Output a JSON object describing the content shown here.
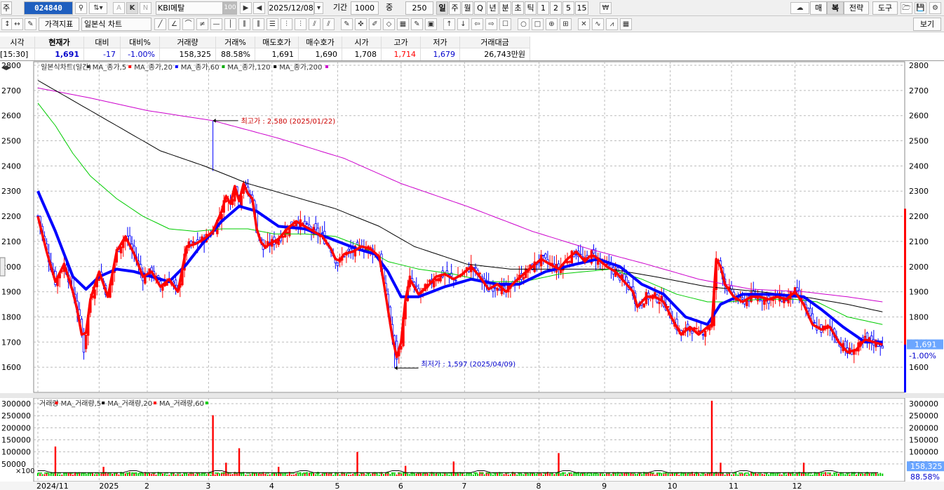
{
  "toolbar1": {
    "mode": "주",
    "code": "024840",
    "name": "KBI메탈",
    "count": "100",
    "date": "2025/12/08",
    "period_label": "기간",
    "period": "1000",
    "zoom_label": "중",
    "zoom": "250",
    "periods": [
      "일",
      "주",
      "월",
      "Q",
      "년",
      "분",
      "초",
      "틱",
      "1",
      "2",
      "5",
      "15"
    ],
    "right": [
      "매",
      "복",
      "전략",
      "도구"
    ],
    "small": [
      "K",
      "N"
    ]
  },
  "toolbar2": {
    "price_index": "가격지표",
    "chart_type": "일본식 차트",
    "view": "보기"
  },
  "quote": {
    "headers": [
      "시각",
      "현재가",
      "대비",
      "대비%",
      "거래량",
      "거래%",
      "매도호가",
      "매수호가",
      "시가",
      "고가",
      "저가",
      "거래대금"
    ],
    "values": [
      "[15:30]",
      "1,691",
      "-17",
      "-1.00%",
      "158,325",
      "88.58%",
      "1,691",
      "1,690",
      "1,708",
      "1,714",
      "1,679",
      "26,743만원"
    ]
  },
  "price_legend": [
    {
      "text": "일본식차트(일간)",
      "color": "#333333"
    },
    {
      "text": "MA_종가,5",
      "color": "#ff0000"
    },
    {
      "text": "MA_종가,20",
      "color": "#0000ff"
    },
    {
      "text": "MA_종가,60",
      "color": "#00aa00"
    },
    {
      "text": "MA_종가,120",
      "color": "#000000"
    },
    {
      "text": "MA_종가,200",
      "color": "#cc00cc"
    }
  ],
  "volume_legend": [
    {
      "text": "거래량",
      "color": "#ff0000"
    },
    {
      "text": "MA_거래량,5",
      "color": "#000000"
    },
    {
      "text": "MA_거래량,20",
      "color": "#ff0000"
    },
    {
      "text": "MA_거래량,60",
      "color": "#00cc00"
    }
  ],
  "annotations": {
    "high": "최고가 : 2,580 (2025/01/22)",
    "low": "최저가 : 1,597 (2025/04/09)"
  },
  "side_labels": {
    "price": "1,691",
    "change": "-1.00%",
    "volume": "158,325",
    "volume_pct": "88.58%"
  },
  "colors": {
    "up": "#ff0000",
    "down": "#0000ff",
    "ma5": "#ff0000",
    "ma20": "#0000ff",
    "ma60": "#00cc00",
    "ma120": "#000000",
    "ma200": "#cc00cc"
  },
  "chart_data": {
    "type": "candlestick",
    "price_axis": {
      "min": 1500,
      "max": 2800,
      "ticks": [
        1600,
        1700,
        1800,
        1900,
        2000,
        2100,
        2200,
        2300,
        2400,
        2500,
        2600,
        2700,
        2800
      ]
    },
    "volume_axis": {
      "min": 0,
      "max": 300000,
      "ticks": [
        50000,
        100000,
        150000,
        200000,
        250000,
        300000
      ],
      "extra_label": "×100"
    },
    "x_labels": [
      "2024/11",
      "2025",
      "2",
      "3",
      "4",
      "5",
      "6",
      "7",
      "8",
      "9",
      "10",
      "11",
      "12"
    ],
    "close_path": [
      [
        0,
        2200
      ],
      [
        4,
        2060
      ],
      [
        8,
        1940
      ],
      [
        12,
        2010
      ],
      [
        16,
        1900
      ],
      [
        19,
        1790
      ],
      [
        21,
        1670
      ],
      [
        24,
        1870
      ],
      [
        28,
        1980
      ],
      [
        32,
        1880
      ],
      [
        36,
        2060
      ],
      [
        40,
        2120
      ],
      [
        44,
        2050
      ],
      [
        48,
        1960
      ],
      [
        52,
        1980
      ],
      [
        56,
        1920
      ],
      [
        60,
        1950
      ],
      [
        64,
        1900
      ],
      [
        68,
        2080
      ],
      [
        72,
        2090
      ],
      [
        76,
        2110
      ],
      [
        80,
        2140
      ],
      [
        84,
        2220
      ],
      [
        86,
        2280
      ],
      [
        88,
        2250
      ],
      [
        90,
        2320
      ],
      [
        92,
        2260
      ],
      [
        94,
        2330
      ],
      [
        96,
        2290
      ],
      [
        98,
        2270
      ],
      [
        100,
        2150
      ],
      [
        103,
        2070
      ],
      [
        106,
        2090
      ],
      [
        110,
        2110
      ],
      [
        114,
        2150
      ],
      [
        118,
        2180
      ],
      [
        122,
        2160
      ],
      [
        126,
        2140
      ],
      [
        130,
        2120
      ],
      [
        134,
        2070
      ],
      [
        137,
        2010
      ],
      [
        140,
        2050
      ],
      [
        144,
        2060
      ],
      [
        148,
        2080
      ],
      [
        152,
        2070
      ],
      [
        156,
        2040
      ],
      [
        158,
        1940
      ],
      [
        160,
        1830
      ],
      [
        162,
        1720
      ],
      [
        164,
        1640
      ],
      [
        166,
        1700
      ],
      [
        168,
        1870
      ],
      [
        170,
        1950
      ],
      [
        174,
        1890
      ],
      [
        178,
        1920
      ],
      [
        182,
        1960
      ],
      [
        186,
        1970
      ],
      [
        190,
        1950
      ],
      [
        194,
        1970
      ],
      [
        198,
        2000
      ],
      [
        202,
        1960
      ],
      [
        206,
        1910
      ],
      [
        210,
        1930
      ],
      [
        214,
        1900
      ],
      [
        218,
        1940
      ],
      [
        222,
        1970
      ],
      [
        226,
        2000
      ],
      [
        230,
        2030
      ],
      [
        234,
        2010
      ],
      [
        238,
        1990
      ],
      [
        242,
        2030
      ],
      [
        246,
        2060
      ],
      [
        250,
        2020
      ],
      [
        253,
        2050
      ],
      [
        256,
        2030
      ],
      [
        260,
        2000
      ],
      [
        264,
        1980
      ],
      [
        268,
        1940
      ],
      [
        272,
        1900
      ],
      [
        274,
        1840
      ],
      [
        278,
        1880
      ],
      [
        282,
        1880
      ],
      [
        286,
        1860
      ],
      [
        290,
        1790
      ],
      [
        294,
        1730
      ],
      [
        298,
        1760
      ],
      [
        302,
        1730
      ],
      [
        306,
        1760
      ],
      [
        308,
        1770
      ],
      [
        310,
        2030
      ],
      [
        312,
        2000
      ],
      [
        314,
        1930
      ],
      [
        318,
        1880
      ],
      [
        322,
        1860
      ],
      [
        326,
        1880
      ],
      [
        330,
        1880
      ],
      [
        334,
        1870
      ],
      [
        338,
        1880
      ],
      [
        342,
        1870
      ],
      [
        346,
        1900
      ],
      [
        350,
        1850
      ],
      [
        354,
        1770
      ],
      [
        358,
        1750
      ],
      [
        362,
        1760
      ],
      [
        366,
        1700
      ],
      [
        370,
        1660
      ],
      [
        374,
        1670
      ],
      [
        378,
        1710
      ],
      [
        382,
        1700
      ],
      [
        386,
        1690
      ]
    ],
    "ma20_path": [
      [
        0,
        2300
      ],
      [
        8,
        2140
      ],
      [
        16,
        1960
      ],
      [
        22,
        1910
      ],
      [
        28,
        1960
      ],
      [
        36,
        1990
      ],
      [
        44,
        1980
      ],
      [
        52,
        1960
      ],
      [
        60,
        1940
      ],
      [
        68,
        2010
      ],
      [
        76,
        2100
      ],
      [
        84,
        2180
      ],
      [
        92,
        2240
      ],
      [
        100,
        2220
      ],
      [
        110,
        2160
      ],
      [
        122,
        2150
      ],
      [
        134,
        2110
      ],
      [
        146,
        2070
      ],
      [
        154,
        2050
      ],
      [
        160,
        1980
      ],
      [
        166,
        1880
      ],
      [
        174,
        1880
      ],
      [
        186,
        1920
      ],
      [
        198,
        1950
      ],
      [
        210,
        1930
      ],
      [
        220,
        1930
      ],
      [
        232,
        1980
      ],
      [
        246,
        2010
      ],
      [
        256,
        2030
      ],
      [
        266,
        2000
      ],
      [
        276,
        1930
      ],
      [
        286,
        1890
      ],
      [
        296,
        1800
      ],
      [
        306,
        1770
      ],
      [
        312,
        1850
      ],
      [
        322,
        1890
      ],
      [
        336,
        1890
      ],
      [
        350,
        1880
      ],
      [
        358,
        1830
      ],
      [
        368,
        1760
      ],
      [
        378,
        1700
      ],
      [
        386,
        1700
      ]
    ],
    "ma60_path": [
      [
        0,
        2650
      ],
      [
        8,
        2560
      ],
      [
        16,
        2450
      ],
      [
        24,
        2360
      ],
      [
        36,
        2270
      ],
      [
        48,
        2200
      ],
      [
        60,
        2150
      ],
      [
        72,
        2140
      ],
      [
        84,
        2150
      ],
      [
        96,
        2150
      ],
      [
        108,
        2130
      ],
      [
        122,
        2130
      ],
      [
        136,
        2120
      ],
      [
        148,
        2080
      ],
      [
        160,
        2020
      ],
      [
        174,
        1990
      ],
      [
        190,
        1970
      ],
      [
        206,
        1940
      ],
      [
        222,
        1940
      ],
      [
        238,
        1970
      ],
      [
        250,
        1980
      ],
      [
        262,
        1990
      ],
      [
        276,
        1950
      ],
      [
        292,
        1890
      ],
      [
        306,
        1860
      ],
      [
        316,
        1860
      ],
      [
        330,
        1870
      ],
      [
        346,
        1870
      ],
      [
        356,
        1860
      ],
      [
        370,
        1800
      ],
      [
        386,
        1770
      ]
    ],
    "ma120_path": [
      [
        0,
        2740
      ],
      [
        16,
        2660
      ],
      [
        36,
        2560
      ],
      [
        56,
        2460
      ],
      [
        76,
        2400
      ],
      [
        96,
        2330
      ],
      [
        116,
        2280
      ],
      [
        136,
        2230
      ],
      [
        156,
        2160
      ],
      [
        172,
        2080
      ],
      [
        196,
        2010
      ],
      [
        216,
        1990
      ],
      [
        240,
        1990
      ],
      [
        262,
        1990
      ],
      [
        282,
        1960
      ],
      [
        306,
        1920
      ],
      [
        330,
        1900
      ],
      [
        350,
        1880
      ],
      [
        370,
        1850
      ],
      [
        386,
        1820
      ]
    ],
    "ma200_path": [
      [
        0,
        2710
      ],
      [
        24,
        2670
      ],
      [
        50,
        2620
      ],
      [
        80,
        2580
      ],
      [
        110,
        2510
      ],
      [
        140,
        2430
      ],
      [
        166,
        2330
      ],
      [
        196,
        2240
      ],
      [
        226,
        2140
      ],
      [
        252,
        2070
      ],
      [
        278,
        2010
      ],
      [
        302,
        1950
      ],
      [
        326,
        1910
      ],
      [
        350,
        1900
      ],
      [
        370,
        1880
      ],
      [
        386,
        1860
      ]
    ],
    "high": 2580,
    "low": 1597,
    "volume_spikes": [
      [
        8,
        122000
      ],
      [
        30,
        38000
      ],
      [
        80,
        252000
      ],
      [
        86,
        55000
      ],
      [
        92,
        115000
      ],
      [
        110,
        38000
      ],
      [
        146,
        100000
      ],
      [
        168,
        42000
      ],
      [
        190,
        60000
      ],
      [
        238,
        95000
      ],
      [
        308,
        312000
      ],
      [
        312,
        55000
      ],
      [
        350,
        55000
      ]
    ]
  }
}
